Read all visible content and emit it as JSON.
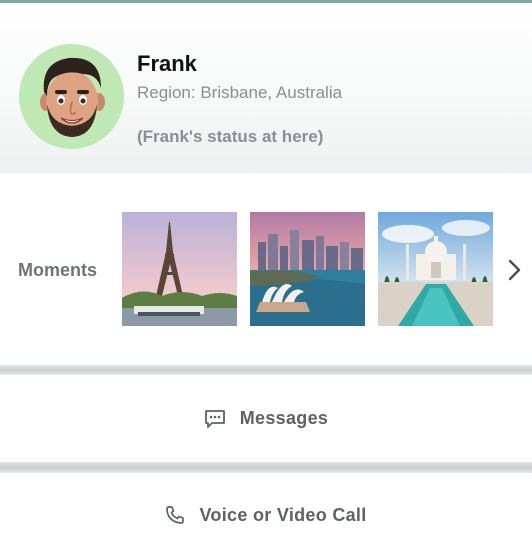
{
  "profile": {
    "name": "Frank",
    "region": "Region: Brisbane,  Australia",
    "status": "(Frank's status at here)",
    "avatar_bg": "#bfe8b5"
  },
  "moments": {
    "label": "Moments",
    "thumbnails": [
      "eiffel-tower-photo",
      "sydney-opera-house-photo",
      "taj-mahal-photo"
    ],
    "more_icon": "chevron-right-icon"
  },
  "actions": {
    "messages_label": "Messages",
    "messages_icon": "message-icon",
    "call_label": "Voice or Video Call",
    "call_icon": "phone-icon"
  }
}
